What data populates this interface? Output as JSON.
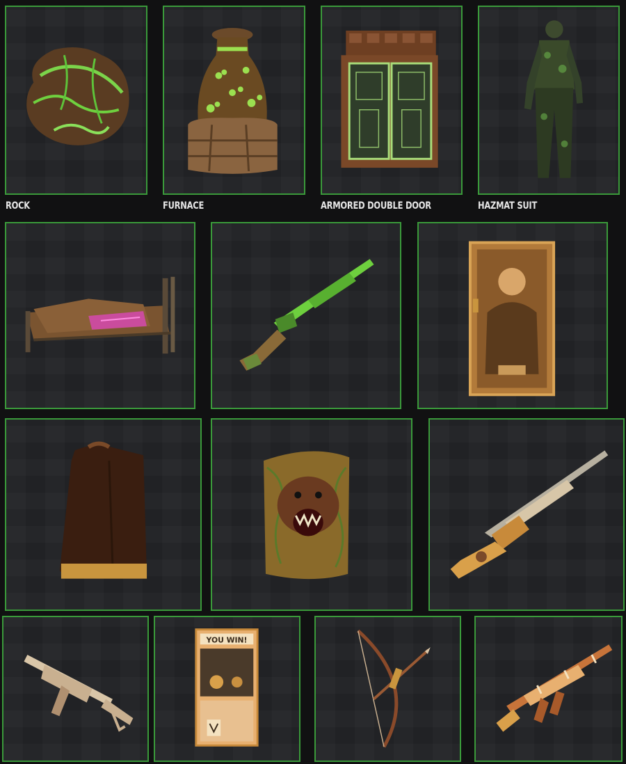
{
  "items": [
    {
      "label": "ROCK"
    },
    {
      "label": "FURNACE"
    },
    {
      "label": "ARMORED DOUBLE DOOR"
    },
    {
      "label": "HAZMAT SUIT"
    }
  ],
  "arcade_sign": "YOU WIN!",
  "colors": {
    "background": "#111112",
    "card": "#232427",
    "border_green": "#3a9a3a",
    "label_text": "#e6e6e6",
    "neon_green": "#6fd13f"
  }
}
